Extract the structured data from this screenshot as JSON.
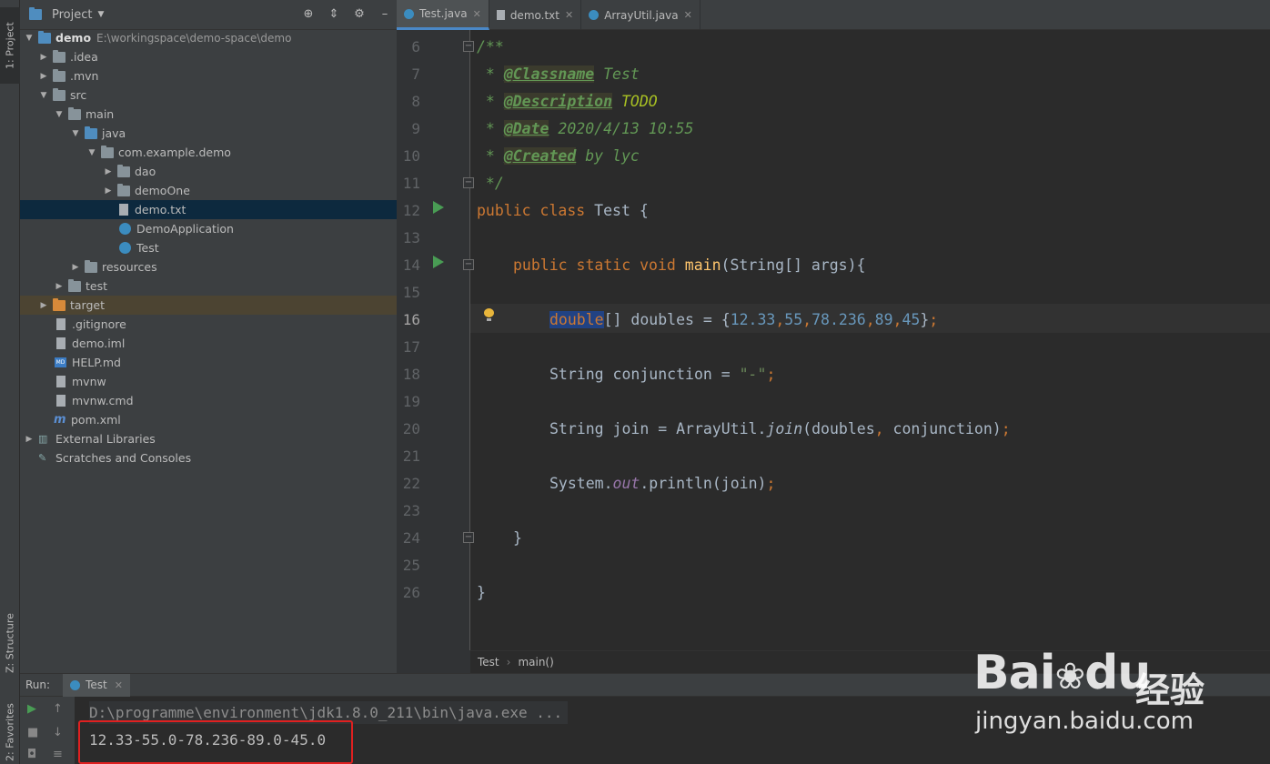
{
  "left_strip": {
    "project_tab": "1: Project",
    "structure_tab": "Z: Structure",
    "favorites_tab": "2: Favorites"
  },
  "project_panel": {
    "title": "Project",
    "tree": [
      {
        "label": "demo",
        "path": "E:\\workingspace\\demo-space\\demo"
      },
      {
        "label": ".idea"
      },
      {
        "label": ".mvn"
      },
      {
        "label": "src"
      },
      {
        "label": "main"
      },
      {
        "label": "java"
      },
      {
        "label": "com.example.demo"
      },
      {
        "label": "dao"
      },
      {
        "label": "demoOne"
      },
      {
        "label": "demo.txt"
      },
      {
        "label": "DemoApplication"
      },
      {
        "label": "Test"
      },
      {
        "label": "resources"
      },
      {
        "label": "test"
      },
      {
        "label": "target"
      },
      {
        "label": ".gitignore"
      },
      {
        "label": "demo.iml"
      },
      {
        "label": "HELP.md"
      },
      {
        "label": "mvnw"
      },
      {
        "label": "mvnw.cmd"
      },
      {
        "label": "pom.xml"
      },
      {
        "label": "External Libraries"
      },
      {
        "label": "Scratches and Consoles"
      }
    ]
  },
  "editor": {
    "tabs": [
      {
        "label": "Test.java"
      },
      {
        "label": "demo.txt"
      },
      {
        "label": "ArrayUtil.java"
      }
    ],
    "line_numbers": [
      "6",
      "7",
      "8",
      "9",
      "10",
      "11",
      "12",
      "13",
      "14",
      "15",
      "16",
      "17",
      "18",
      "19",
      "20",
      "21",
      "22",
      "23",
      "24",
      "25",
      "26"
    ],
    "code": {
      "l6": "/**",
      "l7_star": " * ",
      "l7_tag": "@Classname",
      "l7_rest": " Test",
      "l8_star": " * ",
      "l8_tag": "@Description",
      "l8_rest": " TODO",
      "l9_star": " * ",
      "l9_tag": "@Date",
      "l9_rest": " 2020/4/13 10:55",
      "l10_star": " * ",
      "l10_tag": "@Created",
      "l10_rest": " by lyc",
      "l11": " */",
      "l12_kw1": "public",
      "l12_kw2": "class",
      "l12_rest": " Test {",
      "l14_kw1": "public",
      "l14_kw2": "static",
      "l14_kw3": "void",
      "l14_fn": "main",
      "l14_rest": "(String[] args){",
      "l16_type": "double",
      "l16_a": "[] doubles = {",
      "l16_n1": "12.33",
      "l16_n2": "55",
      "l16_n3": "78.236",
      "l16_n4": "89",
      "l16_n5": "45",
      "l16_end": "}",
      "l18_a": "String conjunction = ",
      "l18_str": "\"-\"",
      "l20_a": "String join = ArrayUtil.",
      "l20_stat": "join",
      "l20_b": "(doubles",
      "l20_c": " conjunction)",
      "l22_a": "System.",
      "l22_field": "out",
      "l22_b": ".println(join)",
      "l24": "}",
      "l26": "}",
      "comma": ",",
      "semi": ";"
    },
    "breadcrumb": [
      "Test",
      "main()"
    ]
  },
  "run_panel": {
    "label": "Run:",
    "tab": "Test",
    "command": "D:\\programme\\environment\\jdk1.8.0_211\\bin\\java.exe ...",
    "output": "12.33-55.0-78.236-89.0-45.0"
  },
  "watermark": {
    "logo": "Bai",
    "logo2": "du",
    "cn": "经验",
    "url": "jingyan.baidu.com"
  }
}
